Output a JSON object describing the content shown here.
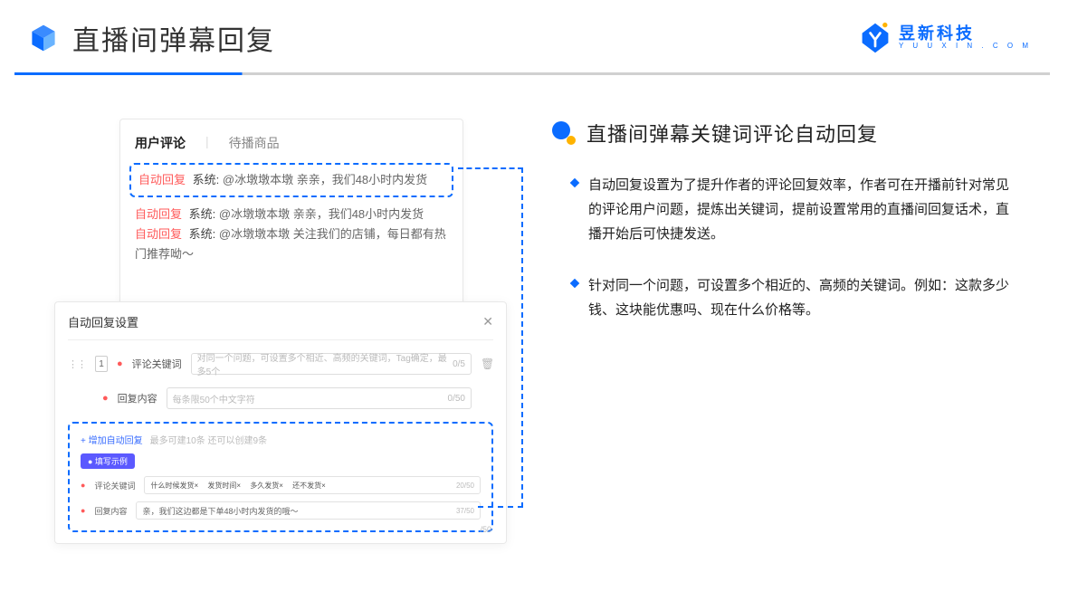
{
  "header": {
    "title": "直播间弹幕回复",
    "brand_cn": "昱新科技",
    "brand_en": "Y U U X I N . C O M"
  },
  "panelA": {
    "tab_active": "用户评论",
    "tab_other": "待播商品",
    "c1": {
      "tag": "自动回复",
      "system": "系统:",
      "text": "@冰墩墩本墩 亲亲，我们48小时内发货"
    },
    "c2": {
      "tag": "自动回复",
      "system": "系统:",
      "text": "@冰墩墩本墩 亲亲，我们48小时内发货"
    },
    "c3": {
      "tag": "自动回复",
      "system": "系统:",
      "text": "@冰墩墩本墩 关注我们的店铺，每日都有热门推荐呦～"
    }
  },
  "panelB": {
    "title": "自动回复设置",
    "num": "1",
    "row1_label": "评论关键词",
    "row1_ph": "对同一个问题，可设置多个相近、高频的关键词，Tag确定，最多5个",
    "row1_cnt": "0/5",
    "row2_label": "回复内容",
    "row2_ph": "每条限50个中文字符",
    "row2_cnt": "0/50",
    "add_label": "+ 增加自动回复",
    "add_hint": "最多可建10条 还可以创建9条",
    "pill": "● 填写示例",
    "ex_kw_label": "评论关键词",
    "ex_kw_tags": "什么时候发货× 　发货时间× 　多久发货× 　还不发货×",
    "ex_kw_cnt": "20/50",
    "ex_rc_label": "回复内容",
    "ex_rc_text": "亲，我们这边都是下单48小时内发货的哦～",
    "ex_rc_cnt": "37/50",
    "stray": "/50"
  },
  "right": {
    "title": "直播间弹幕关键词评论自动回复",
    "b1": "自动回复设置为了提升作者的评论回复效率，作者可在开播前针对常见的评论用户问题，提炼出关键词，提前设置常用的直播间回复话术，直播开始后可快捷发送。",
    "b2": "针对同一个问题，可设置多个相近的、高频的关键词。例如：这款多少钱、这块能优惠吗、现在什么价格等。"
  }
}
